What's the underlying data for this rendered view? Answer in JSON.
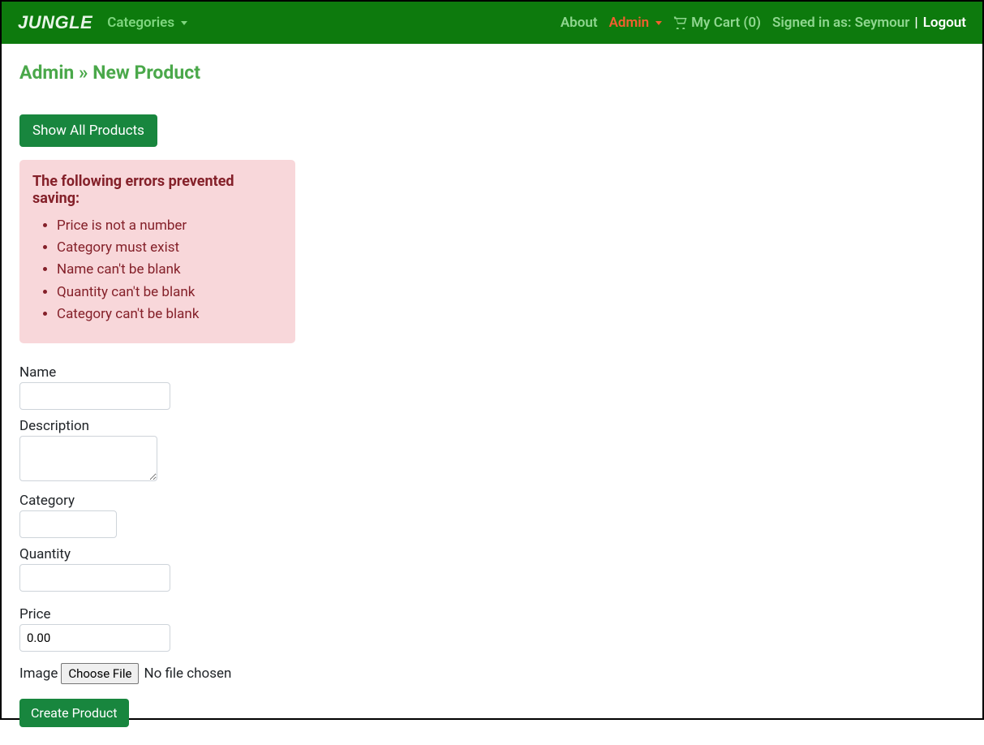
{
  "navbar": {
    "brand": "JUNGLE",
    "categories_label": "Categories",
    "about_label": "About",
    "admin_label": "Admin",
    "cart_label": "My Cart (0)",
    "signed_in_prefix": "Signed in as: ",
    "signed_in_user": "Seymour",
    "logout_label": "Logout"
  },
  "page": {
    "title": "Admin » New Product",
    "show_all_button": "Show All Products",
    "submit_button": "Create Product"
  },
  "alert": {
    "heading": "The following errors prevented saving:",
    "errors": [
      "Price is not a number",
      "Category must exist",
      "Name can't be blank",
      "Quantity can't be blank",
      "Category can't be blank"
    ]
  },
  "form": {
    "name_label": "Name",
    "name_value": "",
    "description_label": "Description",
    "description_value": "",
    "category_label": "Category",
    "category_value": "",
    "quantity_label": "Quantity",
    "quantity_value": "",
    "price_label": "Price",
    "price_value": "0.00",
    "image_label": "Image",
    "choose_file_label": "Choose File",
    "file_status": "No file chosen"
  }
}
